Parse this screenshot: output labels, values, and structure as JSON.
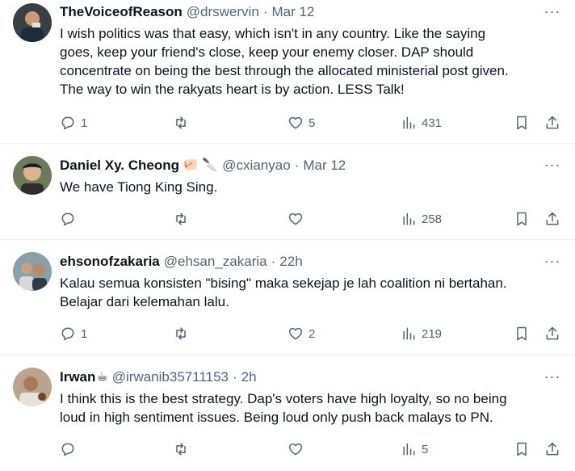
{
  "tweets": [
    {
      "name": "TheVoiceofReason",
      "emoji": "",
      "handle": "@drswervin",
      "time": "Mar 12",
      "text": "I wish politics was that easy, which isn't in any country. Like the saying\ngoes, keep your friend's close, keep your enemy closer.  DAP should\nconcentrate on being the best through the allocated ministerial post given.\nThe way to win the rakyats heart is by action. LESS Talk!",
      "replies": "1",
      "retweets": "",
      "likes": "5",
      "views": "431"
    },
    {
      "name": "Daniel Xy. Cheong",
      "emoji": "🐖 🔪",
      "handle": "@cxianyao",
      "time": "Mar 12",
      "text": "We have Tiong King Sing.",
      "replies": "",
      "retweets": "",
      "likes": "",
      "views": "258"
    },
    {
      "name": "ehsonofzakaria",
      "emoji": "",
      "handle": "@ehsan_zakaria",
      "time": "22h",
      "text": "Kalau semua konsisten \"bising\" maka sekejap je lah coalition ni bertahan.\nBelajar dari kelemahan lalu.",
      "replies": "1",
      "retweets": "",
      "likes": "2",
      "views": "219"
    },
    {
      "name": "Irwan",
      "emoji": "☕",
      "handle": "@irwanib35711153",
      "time": "2h",
      "text": "I think this is the best strategy. Dap's voters have high loyalty, so no being\nloud in high sentiment issues. Being loud only push back malays to PN.",
      "replies": "",
      "retweets": "",
      "likes": "",
      "views": "5"
    }
  ],
  "dot": "·",
  "more_glyph": "···",
  "colors": {
    "text": "#0f1419",
    "secondary": "#536471",
    "divider": "#eff3f4"
  },
  "icons": [
    "reply-icon",
    "retweet-icon",
    "like-icon",
    "views-icon",
    "bookmark-icon",
    "share-icon",
    "more-icon"
  ]
}
